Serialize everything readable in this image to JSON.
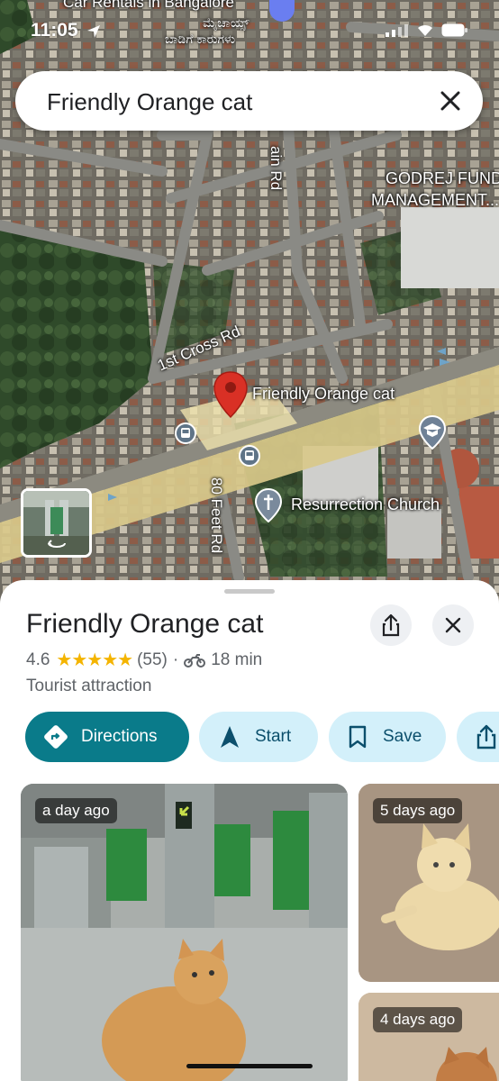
{
  "status_bar": {
    "time": "11:05",
    "top_overlay_text_1": "Car Rentals in Bangalore",
    "top_overlay_text_2": "ಮೈಚಾಯ್ಸ್",
    "top_overlay_text_3": "ಬಾಡಿಗೆ ಕಾರುಗಳು"
  },
  "search": {
    "query": "Friendly Orange cat"
  },
  "map": {
    "labels": {
      "main_rd": "ain Rd",
      "godrej_1": "GODREJ FUND",
      "godrej_2": "MANAGEMENT...",
      "cross_rd": "1st Cross Rd",
      "pin_label": "Friendly Orange cat",
      "feet_rd": "80 Feet Rd",
      "church": "Resurrection Church"
    },
    "pin_color": "#d93025",
    "road_color": "#d9c98a"
  },
  "place": {
    "title": "Friendly Orange cat",
    "rating": "4.6",
    "stars": "★★★★★",
    "review_count": "(55)",
    "separator": "·",
    "travel_time": "18 min",
    "category": "Tourist attraction"
  },
  "actions": {
    "directions": "Directions",
    "start": "Start",
    "save": "Save"
  },
  "photos": [
    {
      "badge": "a day ago"
    },
    {
      "badge": "5 days ago"
    },
    {
      "badge": "4 days ago"
    }
  ],
  "colors": {
    "accent": "#0a7b8a",
    "chip_bg": "#d3f0fa",
    "star": "#f4b400"
  }
}
